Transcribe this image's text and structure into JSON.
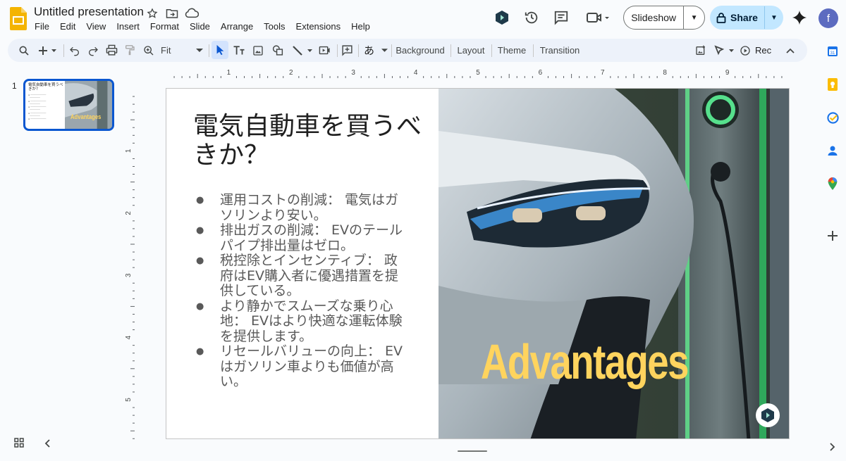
{
  "app": {
    "doc_title": "Untitled presentation",
    "menu": [
      "File",
      "Edit",
      "View",
      "Insert",
      "Format",
      "Slide",
      "Arrange",
      "Tools",
      "Extensions",
      "Help"
    ],
    "slideshow_label": "Slideshow",
    "share_label": "Share",
    "avatar_initial": "f",
    "colors": {
      "accent": "#0b57d0",
      "share_bg": "#c2e7ff",
      "toolbar_bg": "#edf2fa",
      "logo": "#f4b400"
    }
  },
  "toolbar": {
    "zoom_value": "Fit",
    "background_label": "Background",
    "layout_label": "Layout",
    "theme_label": "Theme",
    "transition_label": "Transition",
    "rec_label": "Rec",
    "input_tool_label": "あ"
  },
  "ruler": {
    "h_numbers": [
      "1",
      "2",
      "3",
      "4",
      "5",
      "6",
      "7",
      "8",
      "9"
    ],
    "v_numbers": [
      "1",
      "2",
      "3",
      "4",
      "5"
    ]
  },
  "filmstrip": {
    "slide_number": "1",
    "thumb_title": "電気自動車を買うべきか？",
    "thumb_advantages": "Advantages"
  },
  "slide": {
    "title": "電気自動車を買うべきか？",
    "bullets": [
      "運用コストの削減： 電気はガソリンより安い。",
      "排出ガスの削減： EVのテールパイプ排出量はゼロ。",
      "税控除とインセンティブ： 政府はEV購入者に優遇措置を提供している。",
      "より静かでスムーズな乗り心地： EVはより快適な運転体験を提供します。",
      "リセールバリューの向上： EVはガソリン車よりも価値が高い。"
    ],
    "image_caption": "Advantages",
    "caption_color": "#ffd45e"
  }
}
